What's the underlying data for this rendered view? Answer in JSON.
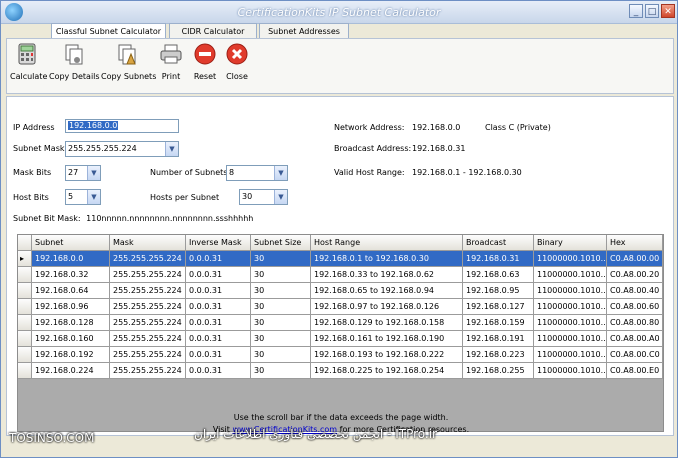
{
  "window": {
    "title": "CertificationKits IP Subnet Calculator",
    "controls": {
      "minimize": "_",
      "maximize": "□",
      "close": "✕"
    }
  },
  "tabs": [
    {
      "label": "Classful Subnet Calculator",
      "active": true
    },
    {
      "label": "CIDR Calculator",
      "active": false
    },
    {
      "label": "Subnet Addresses",
      "active": false
    }
  ],
  "toolbar": {
    "calculate": "Calculate",
    "copy_details": "Copy Details",
    "copy_subnets": "Copy Subnets",
    "print": "Print",
    "reset": "Reset",
    "close": "Close"
  },
  "form": {
    "ip_address_label": "IP Address",
    "ip_address_value": "192.168.0.0",
    "subnet_mask_label": "Subnet Mask",
    "subnet_mask_value": "255.255.255.224",
    "mask_bits_label": "Mask Bits",
    "mask_bits_value": "27",
    "host_bits_label": "Host Bits",
    "host_bits_value": "5",
    "num_subnets_label": "Number of Subnets",
    "num_subnets_value": "8",
    "hosts_per_subnet_label": "Hosts per Subnet",
    "hosts_per_subnet_value": "30",
    "subnet_bit_mask_label": "Subnet Bit Mask:",
    "subnet_bit_mask_value": "110nnnnn.nnnnnnnn.nnnnnnnn.ssshhhhh"
  },
  "info": {
    "network_address_label": "Network Address:",
    "network_address_value": "192.168.0.0",
    "class_value": "Class C (Private)",
    "broadcast_label": "Broadcast Address:",
    "broadcast_value": "192.168.0.31",
    "valid_host_range_label": "Valid Host Range:",
    "valid_host_range_value": "192.168.0.1 - 192.168.0.30"
  },
  "table": {
    "columns": [
      "Subnet",
      "Mask",
      "Inverse Mask",
      "Subnet Size",
      "Host Range",
      "Broadcast",
      "Binary",
      "Hex"
    ],
    "selected_marker": "▸",
    "rows": [
      [
        "192.168.0.0",
        "255.255.255.224",
        "0.0.0.31",
        "30",
        "192.168.0.1 to 192.168.0.30",
        "192.168.0.31",
        "11000000.1010...",
        "C0.A8.00.00"
      ],
      [
        "192.168.0.32",
        "255.255.255.224",
        "0.0.0.31",
        "30",
        "192.168.0.33 to 192.168.0.62",
        "192.168.0.63",
        "11000000.1010...",
        "C0.A8.00.20"
      ],
      [
        "192.168.0.64",
        "255.255.255.224",
        "0.0.0.31",
        "30",
        "192.168.0.65 to 192.168.0.94",
        "192.168.0.95",
        "11000000.1010...",
        "C0.A8.00.40"
      ],
      [
        "192.168.0.96",
        "255.255.255.224",
        "0.0.0.31",
        "30",
        "192.168.0.97 to 192.168.0.126",
        "192.168.0.127",
        "11000000.1010...",
        "C0.A8.00.60"
      ],
      [
        "192.168.0.128",
        "255.255.255.224",
        "0.0.0.31",
        "30",
        "192.168.0.129 to 192.168.0.158",
        "192.168.0.159",
        "11000000.1010...",
        "C0.A8.00.80"
      ],
      [
        "192.168.0.160",
        "255.255.255.224",
        "0.0.0.31",
        "30",
        "192.168.0.161 to 192.168.0.190",
        "192.168.0.191",
        "11000000.1010...",
        "C0.A8.00.A0"
      ],
      [
        "192.168.0.192",
        "255.255.255.224",
        "0.0.0.31",
        "30",
        "192.168.0.193 to 192.168.0.222",
        "192.168.0.223",
        "11000000.1010...",
        "C0.A8.00.C0"
      ],
      [
        "192.168.0.224",
        "255.255.255.224",
        "0.0.0.31",
        "30",
        "192.168.0.225 to 192.168.0.254",
        "192.168.0.255",
        "11000000.1010...",
        "C0.A8.00.E0"
      ]
    ]
  },
  "footer": {
    "line1": "Use the scroll bar if the data exceeds the page width.",
    "line2_prefix": "Visit",
    "link": "www.CertificationKits.com",
    "line2_suffix": "for more Certification resources."
  },
  "watermarks": {
    "left": "TOSINSO.COM",
    "right": "انجمن تخصصی فناوری اطلاعات ایران - ITPro.ir"
  },
  "colors": {
    "selection": "#316ac5",
    "link": "#0000cc",
    "window_bg": "#ece9d8"
  }
}
